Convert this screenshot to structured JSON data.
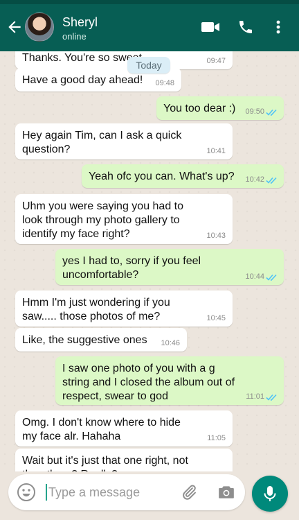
{
  "header": {
    "contact_name": "Sheryl",
    "status": "online"
  },
  "chat": {
    "date_divider": "Today",
    "messages": [
      {
        "dir": "in",
        "text": "Thanks. You're so sweet",
        "time": "09:47"
      },
      {
        "dir": "in",
        "text": "Have a good day ahead!",
        "time": "09:48"
      },
      {
        "dir": "out",
        "text": "You too dear :)",
        "time": "09:50",
        "read": true
      },
      {
        "dir": "in",
        "text": "Hey again Tim, can I ask a quick question?",
        "time": "10:41"
      },
      {
        "dir": "out",
        "text": "Yeah ofc you can. What's up?",
        "time": "10:42",
        "read": true
      },
      {
        "dir": "in",
        "text": "Uhm you were saying you had to look through my photo gallery to identify my face right?",
        "time": "10:43"
      },
      {
        "dir": "out",
        "text": "yes I had to, sorry if you feel uncomfortable?",
        "time": "10:44",
        "read": true
      },
      {
        "dir": "in",
        "text": "Hmm I'm just wondering if you saw..... those photos of me?",
        "time": "10:45"
      },
      {
        "dir": "in",
        "text": "Like, the suggestive ones",
        "time": "10:46"
      },
      {
        "dir": "out",
        "text": "I saw one photo of you with a g string and I closed the album out of respect, swear to god",
        "time": "11:01",
        "read": true
      },
      {
        "dir": "in",
        "text": "Omg. I don't know where to hide my face alr. Hahaha",
        "time": "11:05"
      },
      {
        "dir": "in",
        "text": "Wait but it's just that one right, not the others? Really?",
        "time": ""
      }
    ]
  },
  "composer": {
    "placeholder": "Type a message"
  },
  "colors": {
    "header": "#075e54",
    "outgoing_bubble": "#dcf8c6",
    "incoming_bubble": "#ffffff",
    "read_ticks": "#4fc3f7",
    "mic_button": "#00897b"
  },
  "icons": [
    "back-arrow-icon",
    "video-call-icon",
    "phone-icon",
    "more-vert-icon",
    "emoji-icon",
    "attach-icon",
    "camera-icon",
    "mic-icon",
    "double-check-icon"
  ]
}
